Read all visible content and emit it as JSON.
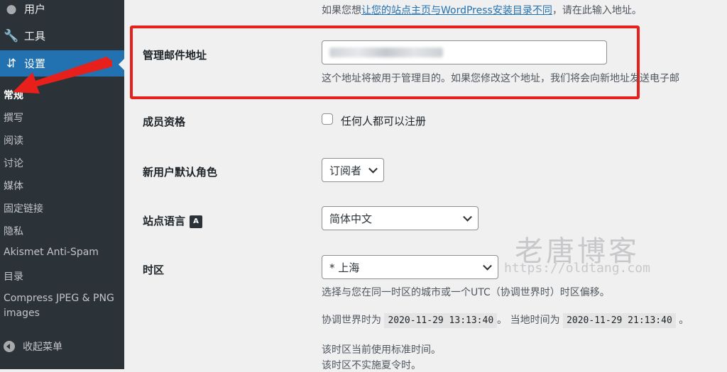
{
  "sidebar": {
    "top_items": [
      {
        "label": "用户",
        "icon": "users-icon"
      },
      {
        "label": "工具",
        "icon": "tools-icon"
      },
      {
        "label": "设置",
        "icon": "settings-icon"
      }
    ],
    "sub_items": [
      {
        "label": "常规"
      },
      {
        "label": "撰写"
      },
      {
        "label": "阅读"
      },
      {
        "label": "讨论"
      },
      {
        "label": "媒体"
      },
      {
        "label": "固定链接"
      },
      {
        "label": "隐私"
      },
      {
        "label": "Akismet Anti-Spam"
      },
      {
        "label": "目录"
      },
      {
        "label": "Compress JPEG & PNG images"
      }
    ],
    "collapse_label": "收起菜单"
  },
  "content": {
    "top_desc_prefix": "如果您想",
    "top_desc_link": "让您的站点主页与WordPress安装目录不同",
    "top_desc_suffix": "，请在此输入地址。",
    "admin_email": {
      "label": "管理邮件地址",
      "desc": "这个地址将被用于管理目的。如果您修改这个地址，我们将会向新地址发送电子邮"
    },
    "membership": {
      "label": "成员资格",
      "checkbox_label": "任何人都可以注册",
      "checked": false
    },
    "default_role": {
      "label": "新用户默认角色",
      "value": "订阅者"
    },
    "site_language": {
      "label": "站点语言",
      "value": "简体中文"
    },
    "timezone": {
      "label": "时区",
      "value": "* 上海",
      "desc": "选择与您在同一时区的城市或一个UTC（协调世界时）时区偏移。",
      "utc_prefix": "协调世界时为",
      "utc_time": "2020-11-29 13:13:40",
      "local_prefix": "。 当地时间为",
      "local_time": "2020-11-29 21:13:40",
      "end": "。",
      "note1": "该时区当前使用标准时间。",
      "note2": "该时区不实施夏令时。"
    },
    "watermark": {
      "title": "老唐博客",
      "url": "https://oldtang.com"
    }
  },
  "colors": {
    "sidebar_bg": "#2c3338",
    "active_bg": "#2271b1",
    "highlight_red": "#e8201c"
  }
}
